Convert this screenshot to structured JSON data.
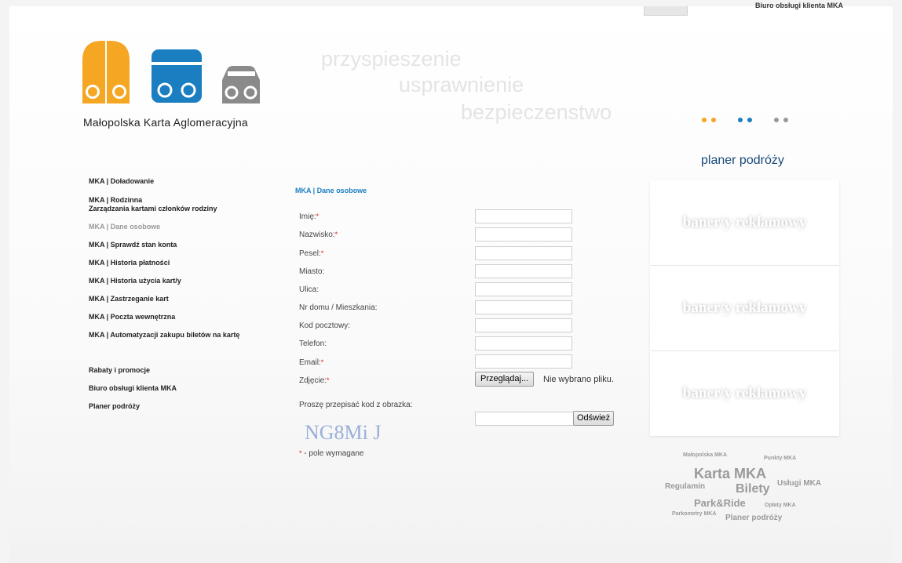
{
  "topbar": {
    "link_label": "Biuro obsługi klienta MKA"
  },
  "logo": {
    "caption": "Małopolska Karta Aglomeracyjna"
  },
  "slogans": [
    "przyspieszenie",
    "usprawnienie",
    "bezpieczenstwo"
  ],
  "dots_colors": [
    "#f5a623",
    "#f5a623",
    "#1a7ec1",
    "#1a7ec1",
    "#999999",
    "#999999"
  ],
  "colors": {
    "accent_orange": "#f5a623",
    "accent_blue": "#1a7ec1",
    "accent_gray": "#8a8a8a"
  },
  "planner": {
    "title": "planer podróży"
  },
  "nav": {
    "items": [
      {
        "label": "MKA | Doładowanie"
      },
      {
        "label": "MKA | Rodzinna"
      },
      {
        "label": "Zarządzania kartami członków rodziny"
      },
      {
        "label": "MKA | Dane osobowe"
      },
      {
        "label": "MKA | Sprawdź stan konta"
      },
      {
        "label": "MKA | Historia płatności"
      },
      {
        "label": "MKA | Historia użycia kart/y"
      },
      {
        "label": "MKA | Zastrzeganie kart"
      },
      {
        "label": "MKA | Poczta wewnętrzna"
      },
      {
        "label": "MKA | Automatyzacji zakupu biletów na kartę"
      }
    ],
    "secondary": [
      {
        "label": "Rabaty i promocje"
      },
      {
        "label": "Biuro obsługi klienta MKA"
      },
      {
        "label": "Planer podróży"
      }
    ]
  },
  "form": {
    "title": "MKA | Dane osobowe",
    "fields": [
      {
        "label": "Imię:",
        "required": "*",
        "value": ""
      },
      {
        "label": "Nazwisko:",
        "required": "*",
        "value": ""
      },
      {
        "label": "Pesel:",
        "required": "*",
        "value": ""
      },
      {
        "label": "Miasto:",
        "required": "",
        "value": ""
      },
      {
        "label": "Ulica:",
        "required": "",
        "value": ""
      },
      {
        "label": "Nr domu / Mieszkania:",
        "required": "",
        "value": ""
      },
      {
        "label": "Kod pocztowy:",
        "required": "",
        "value": ""
      },
      {
        "label": "Telefon:",
        "required": "",
        "value": ""
      },
      {
        "label": "Email:",
        "required": "*",
        "value": ""
      },
      {
        "label": "Zdjęcie:",
        "required": "*"
      }
    ],
    "file_button": "Przeglądaj...",
    "file_status": "Nie wybrano pliku.",
    "captcha_label": "Proszę przepisać kod z obrazka:",
    "captcha_text": "NG8Mi J",
    "captcha_value": "",
    "refresh_button": "Odśwież",
    "required_mark": "*",
    "required_note": " - pole wymagane"
  },
  "banners": [
    "baner/y reklamowy",
    "baner/y reklamowy",
    "baner/y reklamowy"
  ],
  "tags": [
    {
      "label": "Małopolska MKA"
    },
    {
      "label": "Punkty MKA"
    },
    {
      "label": "Karta MKA"
    },
    {
      "label": "Regulamin"
    },
    {
      "label": "Bilety"
    },
    {
      "label": "Usługi MKA"
    },
    {
      "label": "Park&Ride"
    },
    {
      "label": "Opłaty MKA"
    },
    {
      "label": "Parkometry MKA"
    },
    {
      "label": "Planer podróży"
    }
  ]
}
